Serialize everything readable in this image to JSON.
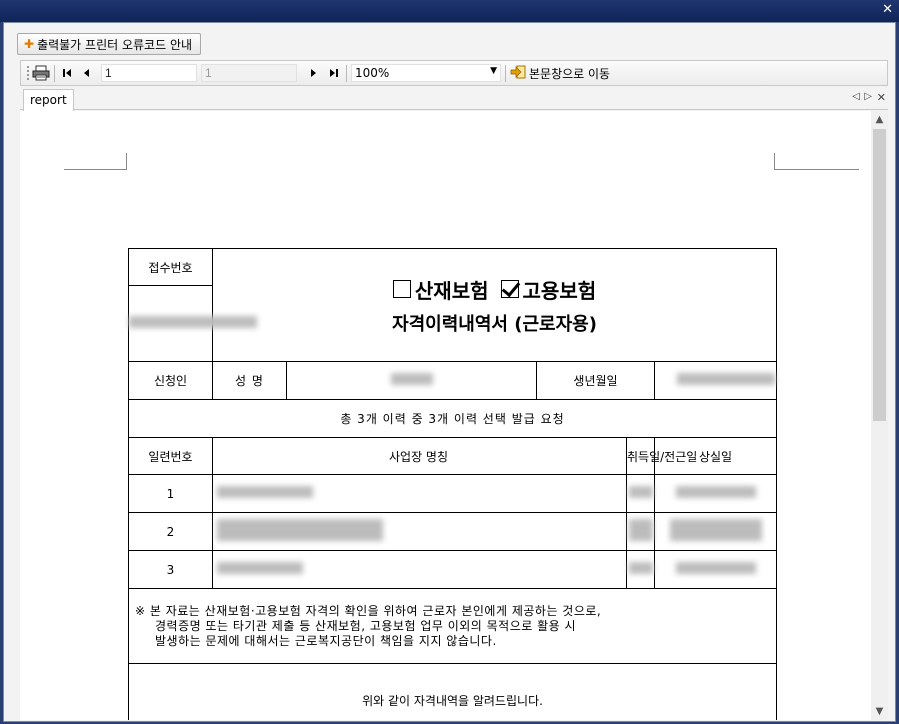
{
  "window": {
    "close_glyph": "✕"
  },
  "top_button": {
    "label": "출력불가 프린터 오류코드 안내",
    "icon": "plus-icon"
  },
  "toolbar": {
    "print_icon": "printer-icon",
    "first_icon": "first-page-icon",
    "prev_icon": "prev-page-icon",
    "next_icon": "next-page-icon",
    "last_icon": "last-page-icon",
    "current_page": "1",
    "total_pages": "1",
    "zoom": "100%",
    "goto_label": "본문창으로 이동",
    "goto_icon": "goto-arrow-icon"
  },
  "tabs": [
    {
      "label": "report"
    }
  ],
  "report": {
    "receipt_no_label": "접수번호",
    "insurance1": "산재보험",
    "insurance1_checked": false,
    "insurance2": "고용보험",
    "insurance2_checked": true,
    "title2": "자격이력내역서 (근로자용)",
    "applicant_label": "신청인",
    "name_label": "성 명",
    "birth_label": "생년월일",
    "summary": "총 3개 이력 중 3개 이력 선택 발급 요청",
    "col_headers": [
      "일련번호",
      "사업장 명칭",
      "취득일/전근일",
      "상실일"
    ],
    "rows": [
      {
        "no": "1"
      },
      {
        "no": "2"
      },
      {
        "no": "3"
      }
    ],
    "notice_lines": [
      "※ 본 자료는 산재보험·고용보험 자격의 확인을 위하여 근로자 본인에게 제공하는 것으로,",
      "경력증명 또는 타기관 제출 등 산재보험, 고용보험 업무 이외의 목적으로 활용 시",
      "발생하는 문제에 대해서는 근로복지공단이 책임을 지지 않습니다."
    ],
    "closing": "위와 같이 자격내역을 알려드립니다."
  }
}
